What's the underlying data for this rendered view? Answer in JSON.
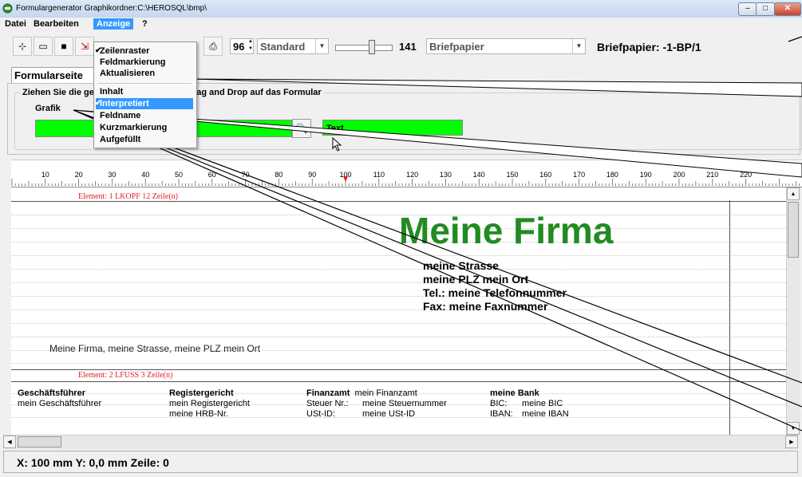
{
  "window": {
    "title": "Formulargenerator  Graphikordner:C:\\HEROSQL\\bmp\\",
    "close": "✕",
    "max": "□",
    "min": "–"
  },
  "menubar": [
    "Datei",
    "Bearbeiten",
    "Anzeige",
    "?"
  ],
  "toolbar": {
    "zoom_value": "96",
    "style_value": "Standard",
    "page_number": "141",
    "paper_value": "Briefpapier",
    "paper_label": "Briefpapier: -1-BP/1"
  },
  "tab_label": "Formularseite",
  "group_caption": "Ziehen Sie die gewünschten Felder mit Drag and Drop auf das Formular",
  "grafik_label": "Grafik",
  "text_field_value": "Text",
  "anzeige_menu": [
    {
      "label": "Zeilenraster",
      "checked": true
    },
    {
      "label": "Feldmarkierung",
      "checked": false
    },
    {
      "label": "Aktualisieren",
      "checked": false
    },
    {
      "label": "Inhalt",
      "checked": false
    },
    {
      "label": "Interpretiert",
      "checked": true,
      "highlighted": true
    },
    {
      "label": "Feldname",
      "checked": false
    },
    {
      "label": "Kurzmarkierung",
      "checked": false
    },
    {
      "label": "Aufgefüllt",
      "checked": false
    }
  ],
  "ruler_ticks": [
    "10",
    "20",
    "30",
    "40",
    "50",
    "60",
    "70",
    "80",
    "90",
    "100",
    "110",
    "120",
    "130",
    "140",
    "150",
    "160",
    "170",
    "180",
    "190",
    "200",
    "210",
    "220"
  ],
  "document": {
    "element1_label": "Element: 1  LKOPF  12 Zeile(n)",
    "element2_label": "Element: 2  LFUSS  3 Zeile(n)",
    "company_name": "Meine Firma",
    "address_lines": [
      "meine Strasse",
      "meine PLZ mein Ort",
      "Tel.: meine Telefonnummer",
      "Fax: meine Faxnummer"
    ],
    "footer_address": "Meine Firma, meine Strasse, meine PLZ mein Ort",
    "footer_cols": {
      "gf_head": "Geschäftsführer",
      "gf_val": "mein Geschäftsführer",
      "reg_head": "Registergericht",
      "reg_val1": "mein Registergericht",
      "reg_val2": "meine HRB-Nr.",
      "fa_head": "Finanzamt",
      "fa_head_val": "mein Finanzamt",
      "st_label": "Steuer Nr.:",
      "st_val": "meine Steuernummer",
      "ust_label": "USt-ID:",
      "ust_val": "meine USt-ID",
      "bank_head": "meine Bank",
      "bic_label": "BIC:",
      "bic_val": "meine BIC",
      "iban_label": "IBAN:",
      "iban_val": "meine IBAN"
    }
  },
  "status": "X: 100 mm  Y:  0,0 mm  Zeile: 0"
}
